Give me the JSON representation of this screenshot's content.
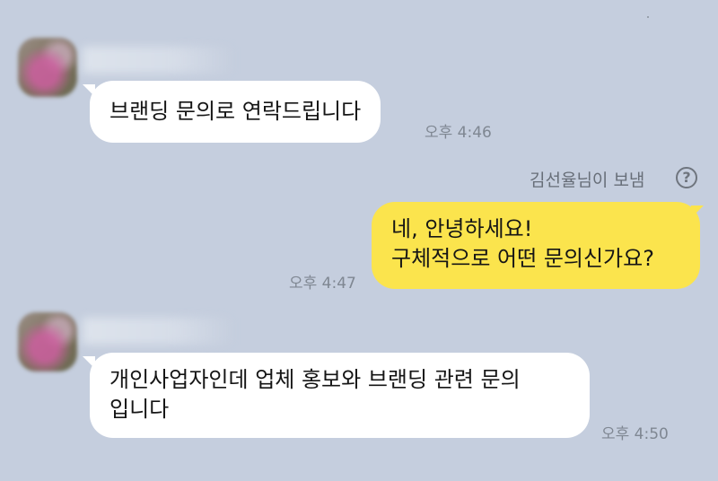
{
  "messages": [
    {
      "text": [
        "브랜딩 문의로 연락드립니다"
      ],
      "time": "오후 4:46"
    },
    {
      "text": [
        "네, 안녕하세요!",
        "구체적으로 어떤 문의신가요?"
      ],
      "time": "오후 4:47",
      "sender_note": "김선율님이 보냄",
      "help_glyph": "?"
    },
    {
      "text": [
        "개인사업자인데 업체 홍보와 브랜딩 관련 문의",
        "입니다"
      ],
      "time": "오후 4:50"
    }
  ],
  "icons": {
    "help": "question-circle-icon",
    "avatar": "blurred-avatar"
  },
  "colors": {
    "background": "#c5cede",
    "outgoing_bubble": "#fbe44d",
    "incoming_bubble": "#ffffff",
    "timestamp": "#7f8792"
  }
}
